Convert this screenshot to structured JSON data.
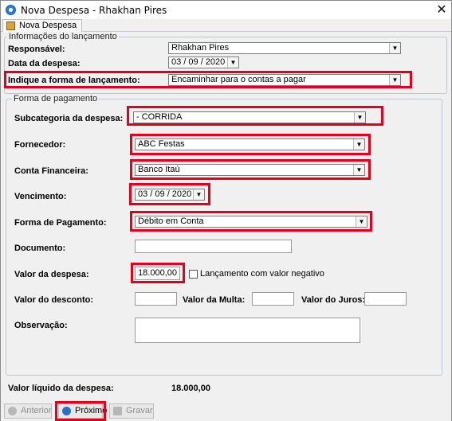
{
  "window": {
    "title": "Nova Despesa - Rhakhan Pires",
    "close_glyph": "✕",
    "tab_label": "Nova Despesa"
  },
  "lancamento": {
    "legend": "Informações do lançamento",
    "responsavel_label": "Responsável:",
    "responsavel_value": "Rhakhan Pires",
    "data_label": "Data da despesa:",
    "data_value": "03 / 09 / 2020",
    "forma_label": "Indique a forma de lançamento:",
    "forma_value": "Encaminhar para o contas a pagar"
  },
  "pagamento": {
    "legend": "Forma de pagamento",
    "subcategoria_label": "Subcategoria da despesa:",
    "subcategoria_value": "- CORRIDA",
    "fornecedor_label": "Fornecedor:",
    "fornecedor_value": "ABC Festas",
    "conta_label": "Conta Financeira:",
    "conta_value": "Banco Itaú",
    "vencimento_label": "Vencimento:",
    "vencimento_value": "03 / 09 / 2020",
    "forma_pag_label": "Forma de Pagamento:",
    "forma_pag_value": "Débito em Conta",
    "documento_label": "Documento:",
    "documento_value": "",
    "valor_label": "Valor da despesa:",
    "valor_value": "18.000,00",
    "negativo_label": "Lançamento com valor negativo",
    "desconto_label": "Valor do desconto:",
    "desconto_value": "",
    "multa_label": "Valor da Multa:",
    "multa_value": "",
    "juros_label": "Valor do Juros:",
    "juros_value": "",
    "observacao_label": "Observação:",
    "observacao_value": ""
  },
  "liquido": {
    "label": "Valor líquido da despesa:",
    "value": "18.000,00"
  },
  "buttons": {
    "anterior": "Anterior",
    "proximo": "Próximo",
    "gravar": "Gravar"
  },
  "colors": {
    "highlight": "#e2001a",
    "group_border": "#b9c7d6"
  },
  "icons": {
    "app": "app-logo-icon",
    "tab": "expense-tab-icon",
    "anterior": "arrow-left-icon",
    "proximo": "arrow-right-icon",
    "gravar": "save-icon"
  }
}
